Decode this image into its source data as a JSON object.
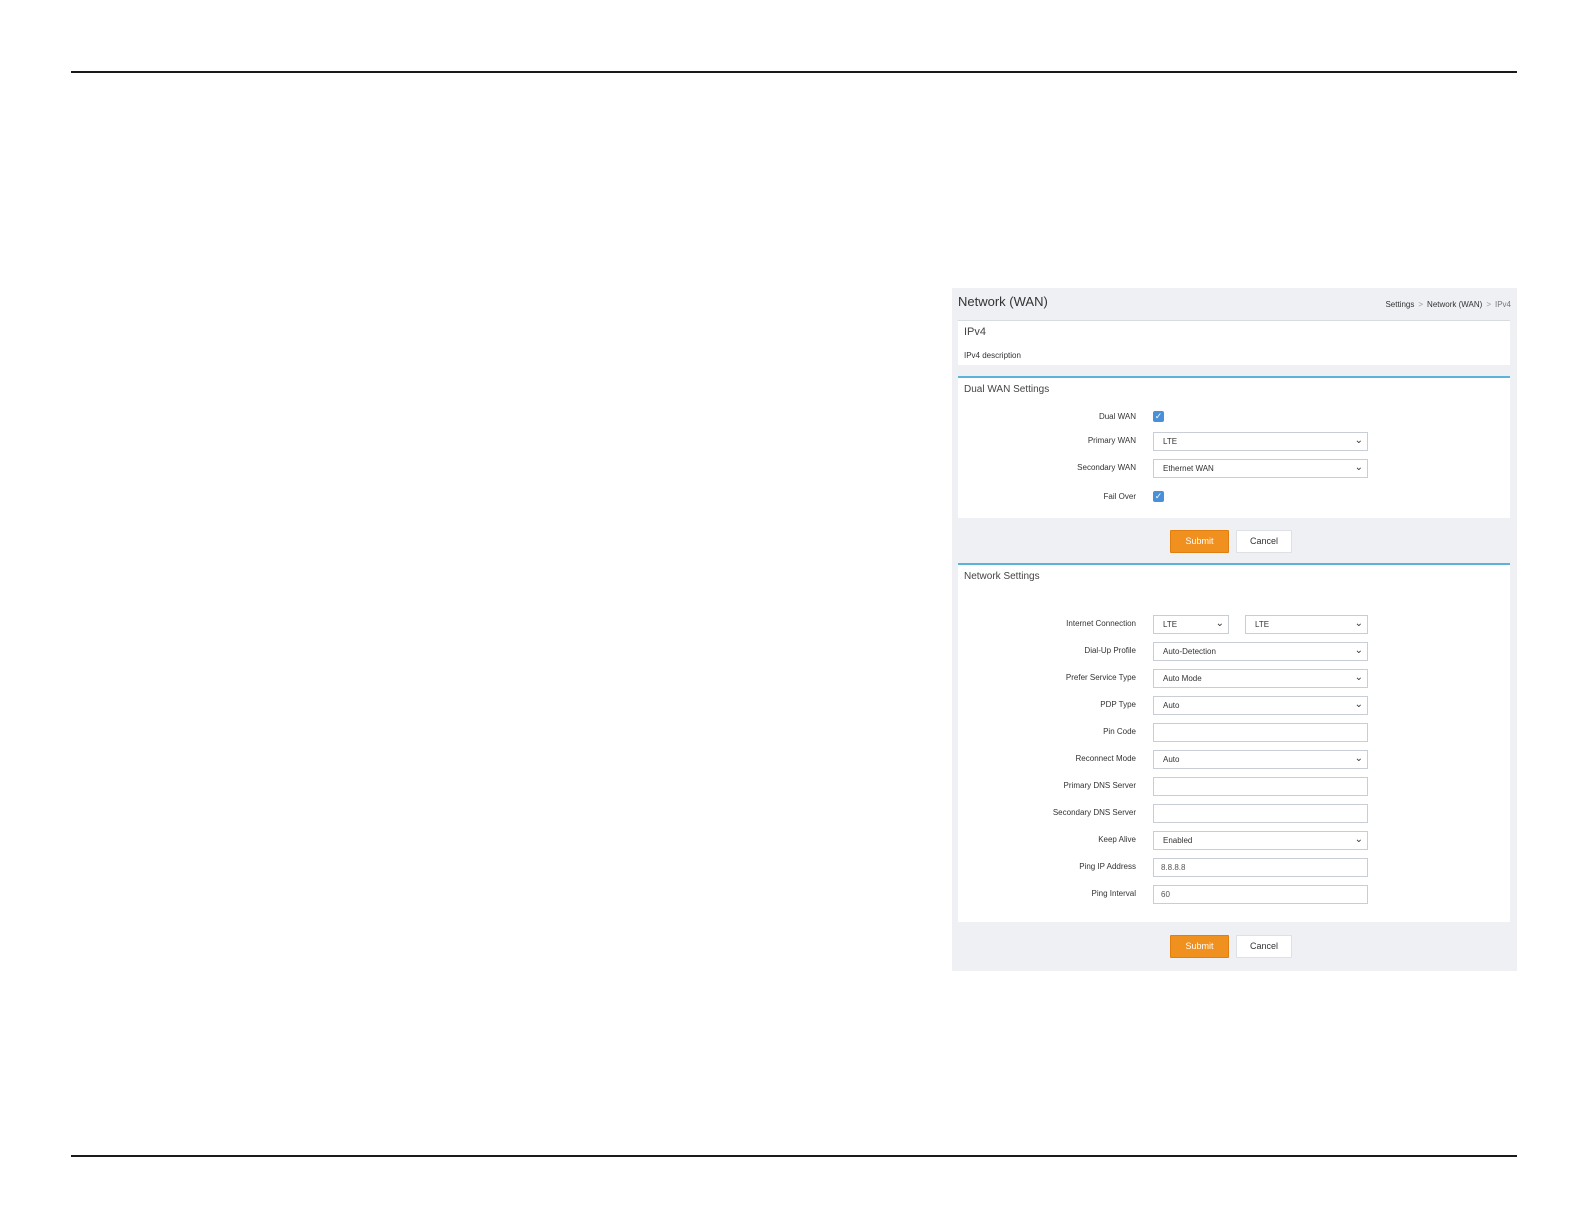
{
  "header": {
    "title": "Network (WAN)",
    "breadcrumb": [
      "Settings",
      "Network (WAN)",
      "IPv4"
    ]
  },
  "intro": {
    "title": "IPv4",
    "description": "IPv4 description"
  },
  "dual_wan": {
    "title": "Dual WAN Settings",
    "dual_wan_label": "Dual WAN",
    "dual_wan_checked": true,
    "primary_label": "Primary WAN",
    "primary_value": "LTE",
    "secondary_label": "Secondary WAN",
    "secondary_value": "Ethernet WAN",
    "failover_label": "Fail Over",
    "failover_checked": true
  },
  "buttons": {
    "submit": "Submit",
    "cancel": "Cancel"
  },
  "network": {
    "title": "Network Settings",
    "internet_connection_label": "Internet Connection",
    "internet_connection_value": "LTE",
    "internet_connection_value2": "LTE",
    "dialup_label": "Dial-Up Profile",
    "dialup_value": "Auto-Detection",
    "service_type_label": "Prefer Service Type",
    "service_type_value": "Auto Mode",
    "pdp_label": "PDP Type",
    "pdp_value": "Auto",
    "pin_label": "Pin Code",
    "pin_value": "",
    "reconnect_label": "Reconnect Mode",
    "reconnect_value": "Auto",
    "primary_dns_label": "Primary DNS Server",
    "primary_dns_value": "",
    "secondary_dns_label": "Secondary DNS Server",
    "secondary_dns_value": "",
    "keep_alive_label": "Keep Alive",
    "keep_alive_value": "Enabled",
    "ping_ip_label": "Ping IP Address",
    "ping_ip_value": "8.8.8.8",
    "ping_interval_label": "Ping Interval",
    "ping_interval_value": "60"
  },
  "colors": {
    "accent_orange": "#f0901e",
    "section_line": "#5bb3dc",
    "checkbox": "#4a90d9"
  }
}
